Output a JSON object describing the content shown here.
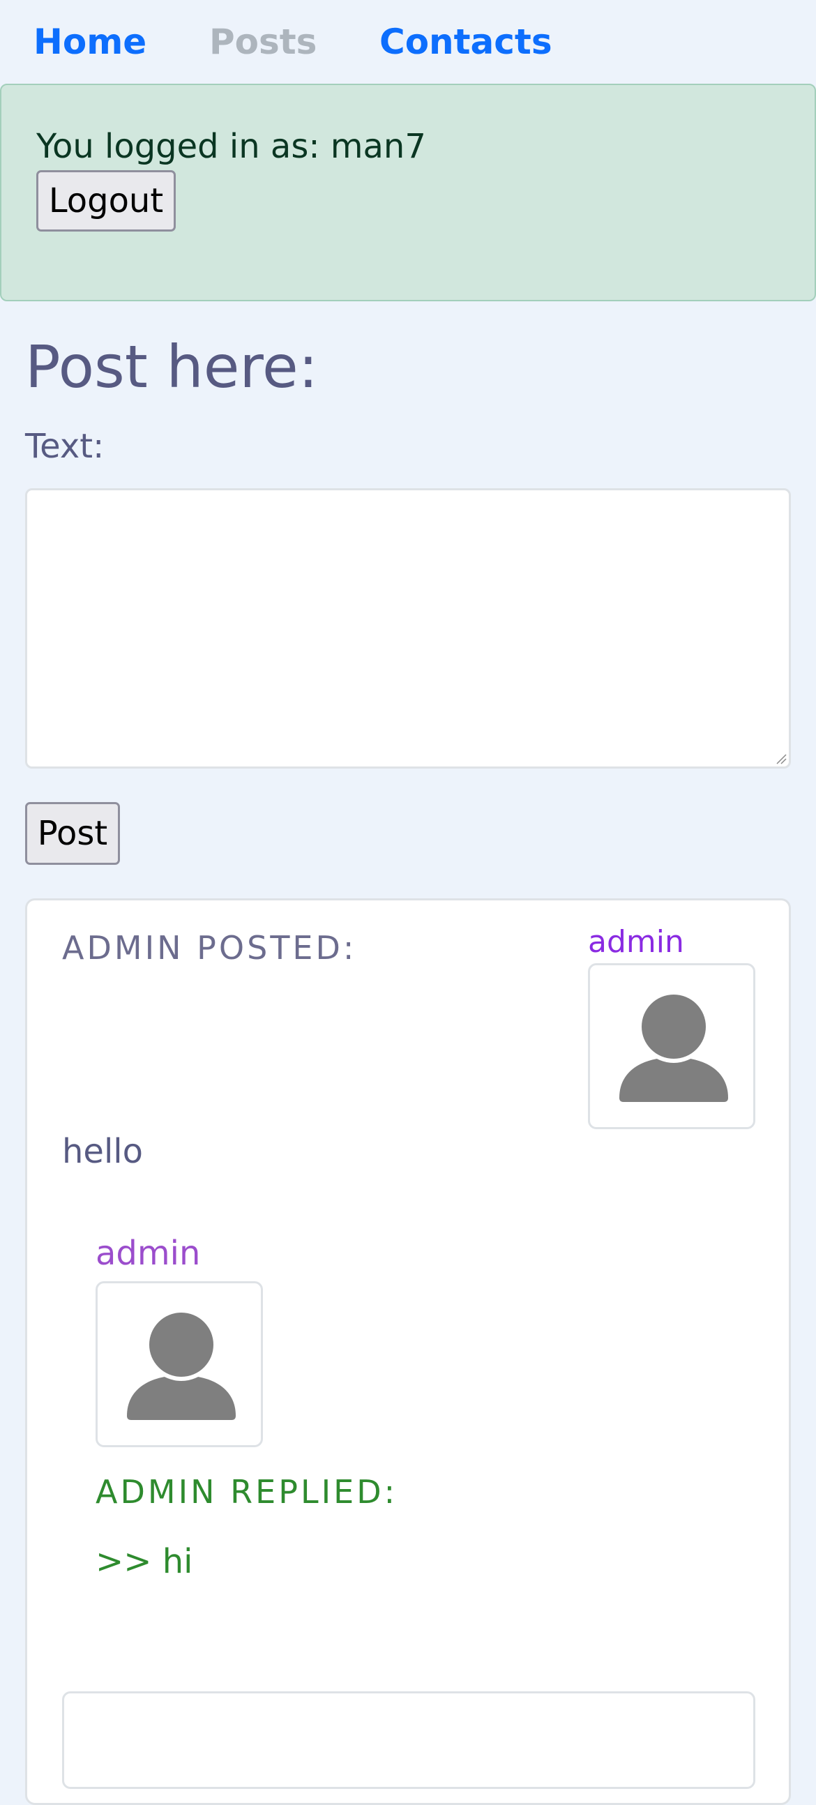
{
  "nav": {
    "home": "Home",
    "posts": "Posts",
    "contacts": "Contacts"
  },
  "alert": {
    "logged_in_text": "You logged in as: man7",
    "logout_label": "Logout"
  },
  "form": {
    "title": "Post here:",
    "text_label": "Text:",
    "text_value": "",
    "post_label": "Post"
  },
  "posts": [
    {
      "header": "ADMIN POSTED:",
      "author": "admin",
      "avatar_icon": "user-silhouette-icon",
      "body": "hello",
      "replies": [
        {
          "author": "admin",
          "avatar_icon": "user-silhouette-icon",
          "header": "ADMIN REPLIED:",
          "text": ">> hi"
        }
      ],
      "reply_input_value": ""
    }
  ],
  "colors": {
    "page_bg": "#edf3fb",
    "nav_active": "#0d6efd",
    "nav_disabled": "#adb5bd",
    "alert_bg": "#d1e7dd",
    "heading": "#575a82",
    "author": "#8a2be2",
    "reply": "#2e8b2e"
  }
}
